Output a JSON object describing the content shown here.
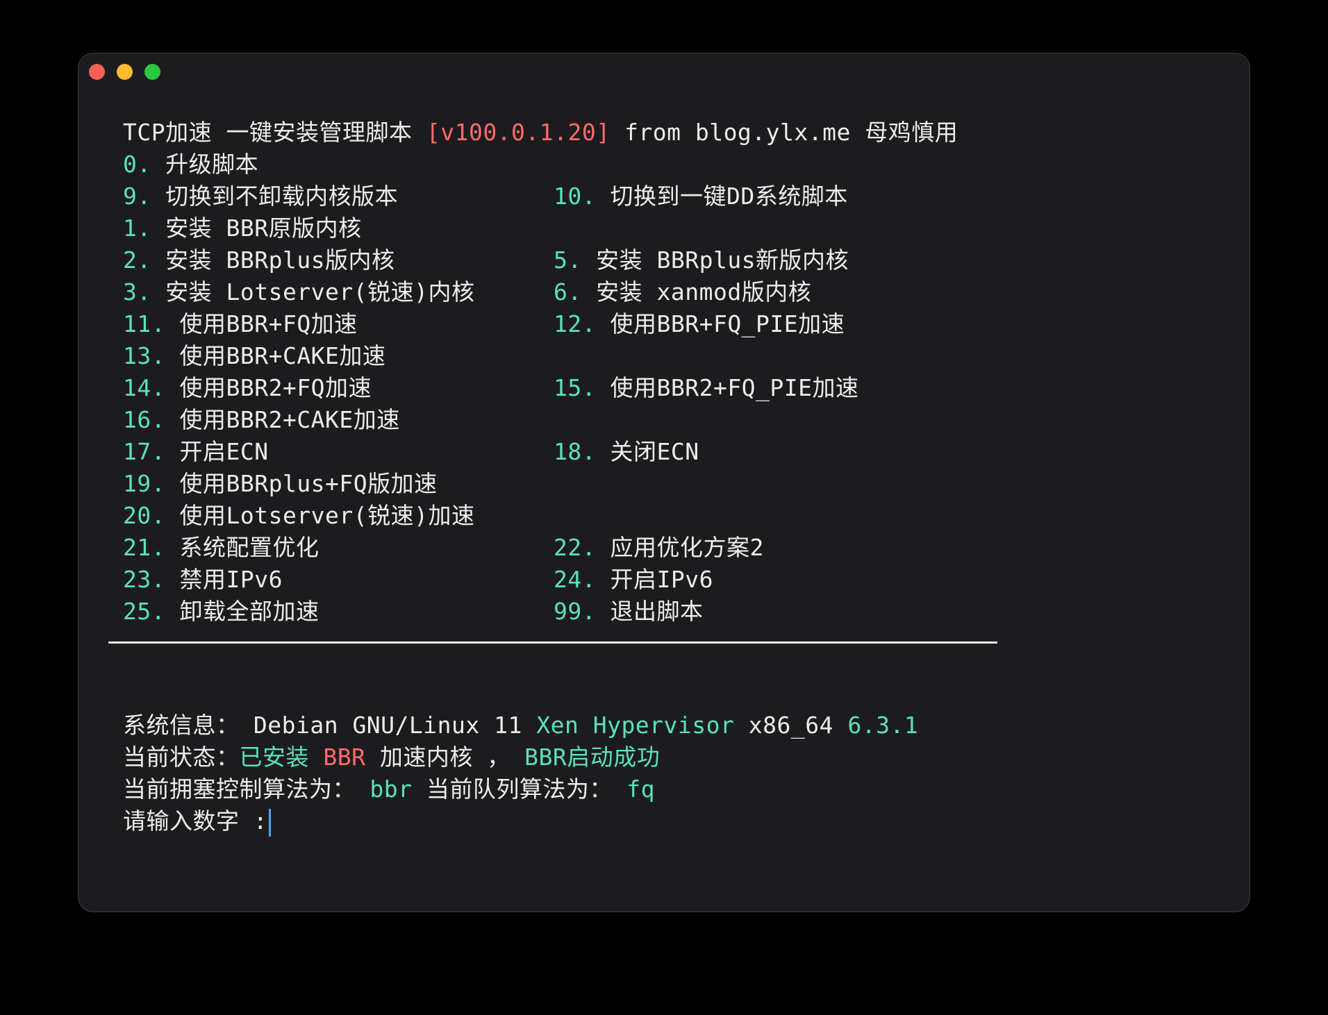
{
  "title_line": {
    "prefix": "TCP加速 一键安装管理脚本 ",
    "version": "[v100.0.1.20]",
    "suffix": " from blog.ylx.me 母鸡慎用"
  },
  "menu": [
    {
      "left": {
        "num": "0.",
        "label": " 升级脚本"
      }
    },
    {
      "left": {
        "num": "9.",
        "label": " 切换到不卸载内核版本"
      },
      "right": {
        "num": "10.",
        "label": " 切换到一键DD系统脚本"
      }
    },
    {
      "left": {
        "num": "1.",
        "label": " 安装 BBR原版内核"
      }
    },
    {
      "left": {
        "num": "2.",
        "label": " 安装 BBRplus版内核"
      },
      "right": {
        "num": "5.",
        "label": " 安装 BBRplus新版内核"
      }
    },
    {
      "left": {
        "num": "3.",
        "label": " 安装 Lotserver(锐速)内核"
      },
      "right": {
        "num": "6.",
        "label": " 安装 xanmod版内核"
      }
    },
    {
      "left": {
        "num": "11.",
        "label": " 使用BBR+FQ加速"
      },
      "right": {
        "num": "12.",
        "label": " 使用BBR+FQ_PIE加速"
      }
    },
    {
      "left": {
        "num": "13.",
        "label": " 使用BBR+CAKE加速"
      }
    },
    {
      "left": {
        "num": "14.",
        "label": " 使用BBR2+FQ加速"
      },
      "right": {
        "num": "15.",
        "label": " 使用BBR2+FQ_PIE加速"
      }
    },
    {
      "left": {
        "num": "16.",
        "label": " 使用BBR2+CAKE加速"
      }
    },
    {
      "left": {
        "num": "17.",
        "label": " 开启ECN"
      },
      "right": {
        "num": "18.",
        "label": " 关闭ECN"
      }
    },
    {
      "left": {
        "num": "19.",
        "label": " 使用BBRplus+FQ版加速"
      }
    },
    {
      "left": {
        "num": "20.",
        "label": " 使用Lotserver(锐速)加速"
      }
    },
    {
      "left": {
        "num": "21.",
        "label": " 系统配置优化"
      },
      "right": {
        "num": "22.",
        "label": " 应用优化方案2"
      }
    },
    {
      "left": {
        "num": "23.",
        "label": " 禁用IPv6"
      },
      "right": {
        "num": "24.",
        "label": " 开启IPv6"
      }
    },
    {
      "left": {
        "num": "25.",
        "label": " 卸载全部加速"
      },
      "right": {
        "num": "99.",
        "label": " 退出脚本"
      }
    }
  ],
  "system_info": {
    "label": "系统信息：",
    "os": " Debian GNU/Linux 11 ",
    "virt": "Xen Hypervisor",
    "arch": " x86_64 ",
    "kernel": "6.3.1"
  },
  "status": {
    "label": "当前状态：",
    "installed": "已安装",
    "bbr": " BBR",
    "mid": " 加速内核 ，",
    "result": " BBR启动成功"
  },
  "algo": {
    "label": "当前拥塞控制算法为：",
    "cc": " bbr",
    "queue_label": " 当前队列算法为：",
    "queue": " fq"
  },
  "prompt": {
    "text": "请输入数字 :"
  },
  "colors": {
    "number": "#5ae3b7",
    "version": "#ff6b6b",
    "background": "#1c1c1f"
  }
}
